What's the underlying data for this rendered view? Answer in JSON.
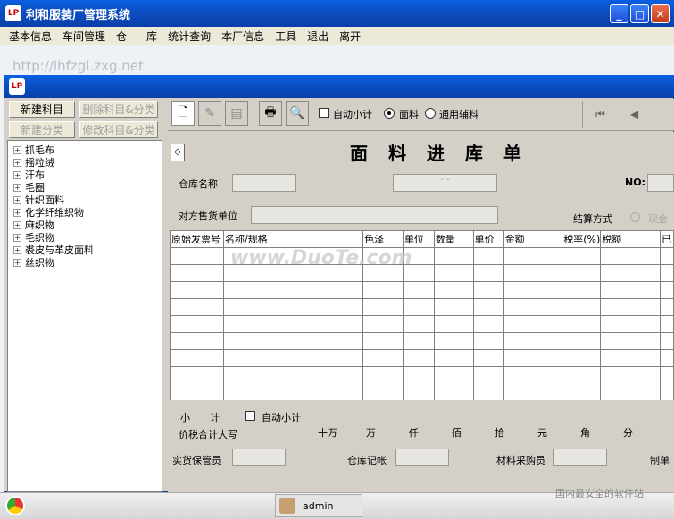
{
  "outer_window": {
    "title": "利和服装厂管理系统",
    "logo": "LP"
  },
  "menubar": [
    "基本信息",
    "车间管理",
    "仓",
    "库",
    "统计查询",
    "本厂信息",
    "工具",
    "退出",
    "离开"
  ],
  "desktop": {
    "url": "http://lhfzgl.zxg.net"
  },
  "inner_window": {
    "logo": "LP"
  },
  "left_panel": {
    "new_subject": "新建科目",
    "delete_subject": "删除科目&分类",
    "new_category": "新建分类",
    "modify_subject": "修改科目&分类",
    "tree": [
      "抓毛布",
      "摇粒绒",
      "汗布",
      "毛圈",
      "针织面料",
      "化学纤维织物",
      "麻织物",
      "毛织物",
      "裘皮与革皮面料",
      "丝织物"
    ]
  },
  "toolbar": {
    "auto_subtotal": "自动小计",
    "fabric": "面料",
    "general_accessory": "通用辅料"
  },
  "form": {
    "title": "面 料 进 库 单",
    "warehouse_name": "仓库名称",
    "no_label": "NO:",
    "counterparty": "对方售货单位",
    "settlement": "结算方式",
    "cash": "现金",
    "columns": [
      "原始发票号",
      "名称/规格",
      "色泽",
      "单位",
      "数量",
      "单价",
      "金额",
      "税率(%)",
      "税额",
      "已"
    ],
    "subtotal": "小　　计",
    "auto_subtotal": "自动小计",
    "total_caps": "价税合计大写",
    "units": [
      "十万",
      "万",
      "仟",
      "佰",
      "拾",
      "元",
      "角",
      "分"
    ],
    "keeper": "实货保管员",
    "ledger": "仓库记帐",
    "buyer": "材料采购员",
    "maker": "制单"
  },
  "taskbar": {
    "user": "admin"
  },
  "watermark": {
    "main": "www.DuoTe.com",
    "footer": "国内最安全的软件站"
  }
}
